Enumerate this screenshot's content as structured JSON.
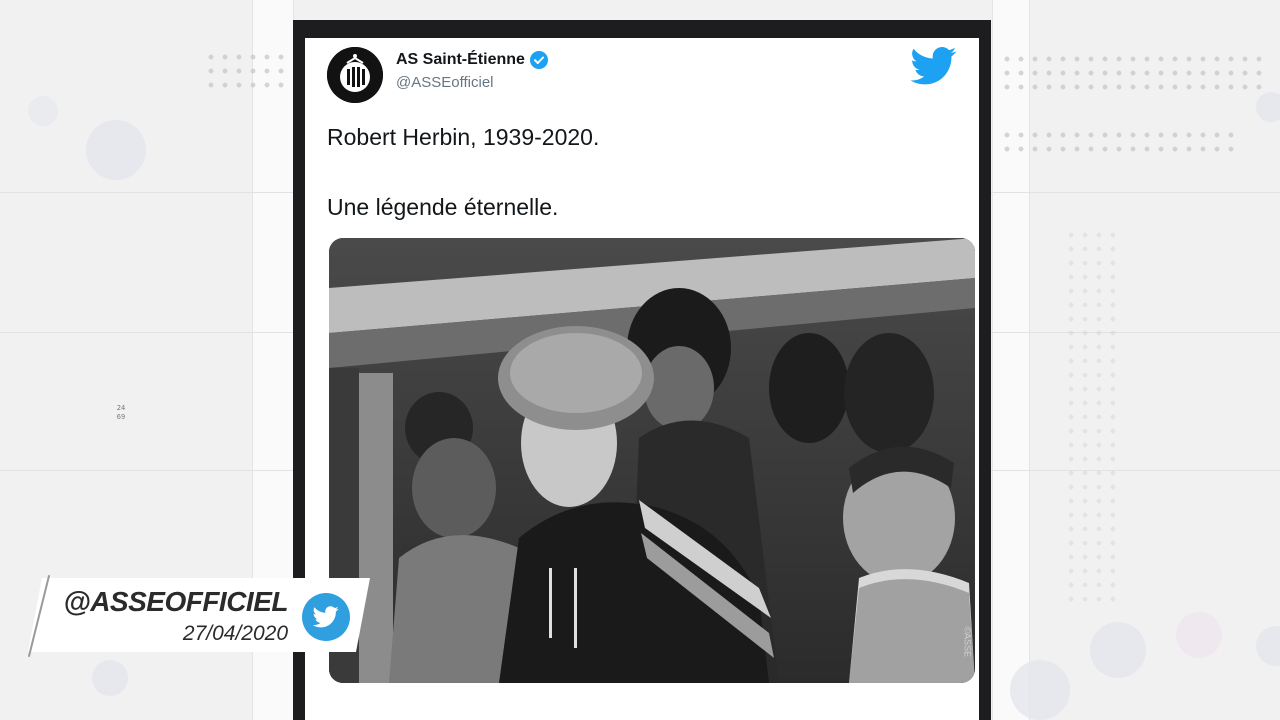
{
  "tweet": {
    "account_name": "AS Saint-Étienne",
    "handle": "@ASSEofficiel",
    "text_line_1": "Robert Herbin, 1939-2020.",
    "text_line_2": "Une légende éternelle.",
    "photo_credit": "©ASSE",
    "verified_color": "#1da1f2",
    "twitter_icon": "twitter-bird-icon"
  },
  "banner": {
    "handle": "@ASSEOFFICIEL",
    "date": "27/04/2020",
    "icon": "twitter-bird-icon",
    "icon_color": "#2f9fe0"
  },
  "background": {
    "side_code": "2469"
  }
}
